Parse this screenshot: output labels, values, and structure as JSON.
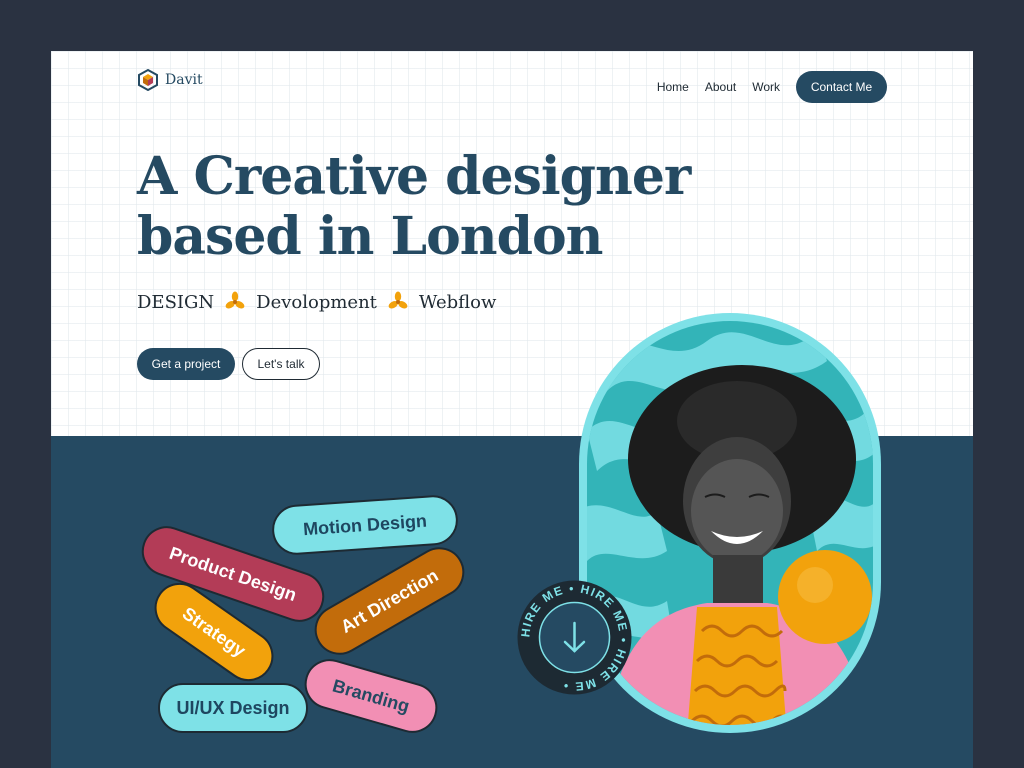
{
  "brand": {
    "name": "Davit",
    "icon": "cube-logo-icon"
  },
  "nav": {
    "items": [
      "Home",
      "About",
      "Work"
    ],
    "contact_label": "Contact Me"
  },
  "hero": {
    "headline_line1": "A Creative designer",
    "headline_line2": "based in London",
    "tags": [
      "DESIGN",
      "Devolopment",
      "Webflow"
    ],
    "tag_separator_icon": "flower-star-icon",
    "primary_cta": "Get a project",
    "secondary_cta": "Let's talk"
  },
  "skills": [
    "Product Design",
    "Motion Design",
    "Art Direction",
    "Strategy",
    "Branding",
    "UI/UX Design"
  ],
  "hire_badge": {
    "text": "HIRE ME • HIRE ME • HIRE ME • ",
    "icon": "arrow-down-icon"
  },
  "colors": {
    "navy": "#254a62",
    "background": "#2a3241",
    "teal": "#7ee1e7",
    "orange": "#f2a20c",
    "crimson": "#b33c57",
    "pink": "#f28fb4",
    "amber": "#c26c0b"
  }
}
